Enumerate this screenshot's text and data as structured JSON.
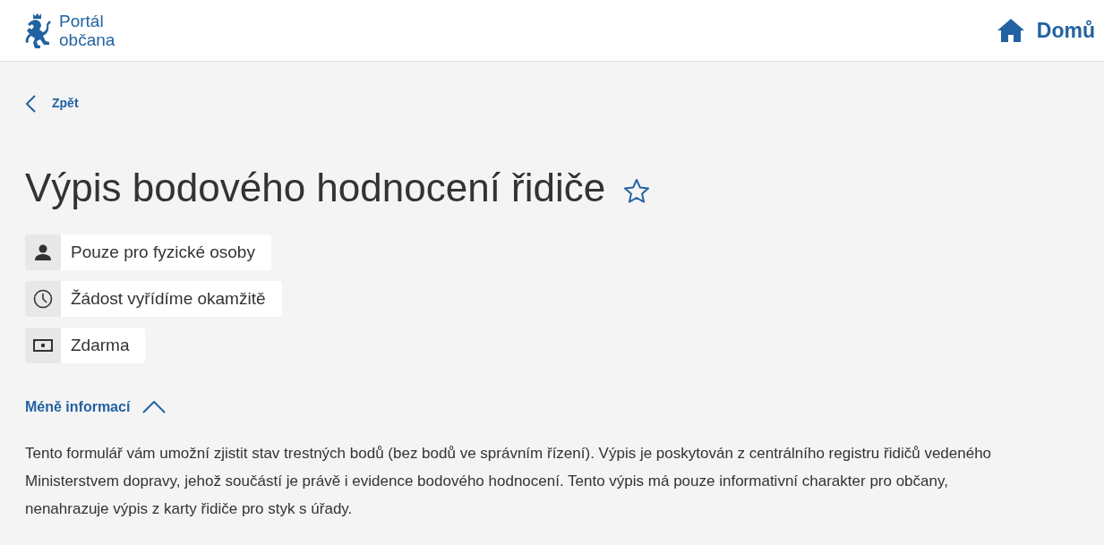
{
  "header": {
    "logo_lines": [
      "Portál",
      "občana"
    ],
    "home_link": "Domů"
  },
  "back_link": "Zpět",
  "title": "Výpis bodového hodnocení řidiče",
  "favorite": false,
  "badges": [
    {
      "kind": "person",
      "text": "Pouze pro fyzické osoby"
    },
    {
      "kind": "clock",
      "text": "Žádost vyřídíme okamžitě"
    },
    {
      "kind": "money",
      "text": "Zdarma"
    }
  ],
  "toggle": {
    "label": "Méně informací",
    "expanded": true
  },
  "description": "Tento formulář vám umožní zjistit stav trestných bodů (bez bodů ve správním řízení). Výpis je poskytován z centrálního registru řidičů vedeného Ministerstvem dopravy, jehož součástí je právě i evidence bodového hodnocení. Tento výpis má pouze informativní charakter pro občany, nenahrazuje výpis z karty řidiče pro styk s úřady."
}
